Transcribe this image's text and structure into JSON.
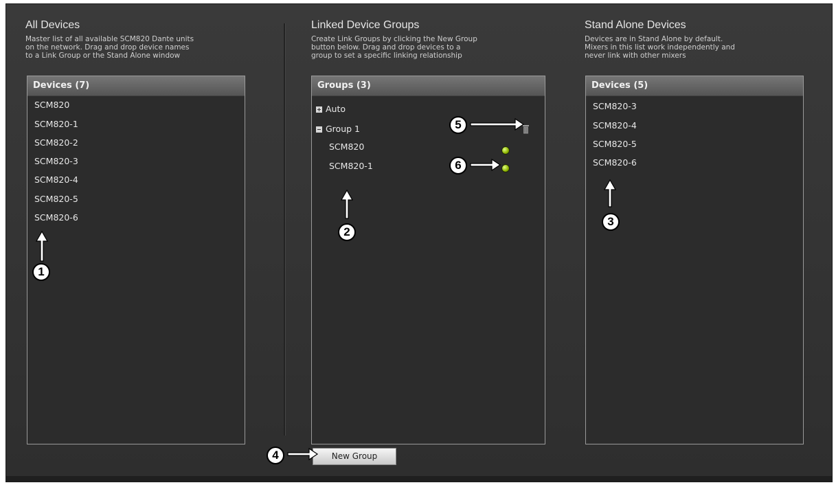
{
  "all_devices": {
    "title": "All Devices",
    "description": "Master list of all available SCM820 Dante units\non the network. Drag and drop device names\nto a Link Group or the Stand Alone window",
    "header": "Devices (7)",
    "items": [
      "SCM820",
      "SCM820-1",
      "SCM820-2",
      "SCM820-3",
      "SCM820-4",
      "SCM820-5",
      "SCM820-6"
    ]
  },
  "linked_groups": {
    "title": "Linked Device Groups",
    "description": "Create Link Groups by clicking the New Group\nbutton below. Drag and drop devices to a\ngroup to set a specific linking relationship",
    "header": "Groups (3)",
    "groups": [
      {
        "label": "Auto",
        "expanded": false,
        "members": []
      },
      {
        "label": "Group 1",
        "expanded": true,
        "members": [
          "SCM820",
          "SCM820-1"
        ]
      }
    ],
    "new_group_label": "New Group"
  },
  "stand_alone": {
    "title": "Stand Alone Devices",
    "description": "Devices are in Stand Alone by default.\nMixers in this list work independently and\nnever link with other mixers",
    "header": "Devices (5)",
    "items": [
      "SCM820-3",
      "SCM820-4",
      "SCM820-5",
      "SCM820-6"
    ]
  },
  "callouts": [
    "1",
    "2",
    "3",
    "4",
    "5",
    "6"
  ],
  "colors": {
    "background": "#333333",
    "panel": "#2c2c2c",
    "led": "#8db300"
  },
  "icons": {
    "expand": "plus-box-icon",
    "collapse": "minus-box-icon",
    "delete": "trash-icon",
    "status": "green-led-icon"
  }
}
